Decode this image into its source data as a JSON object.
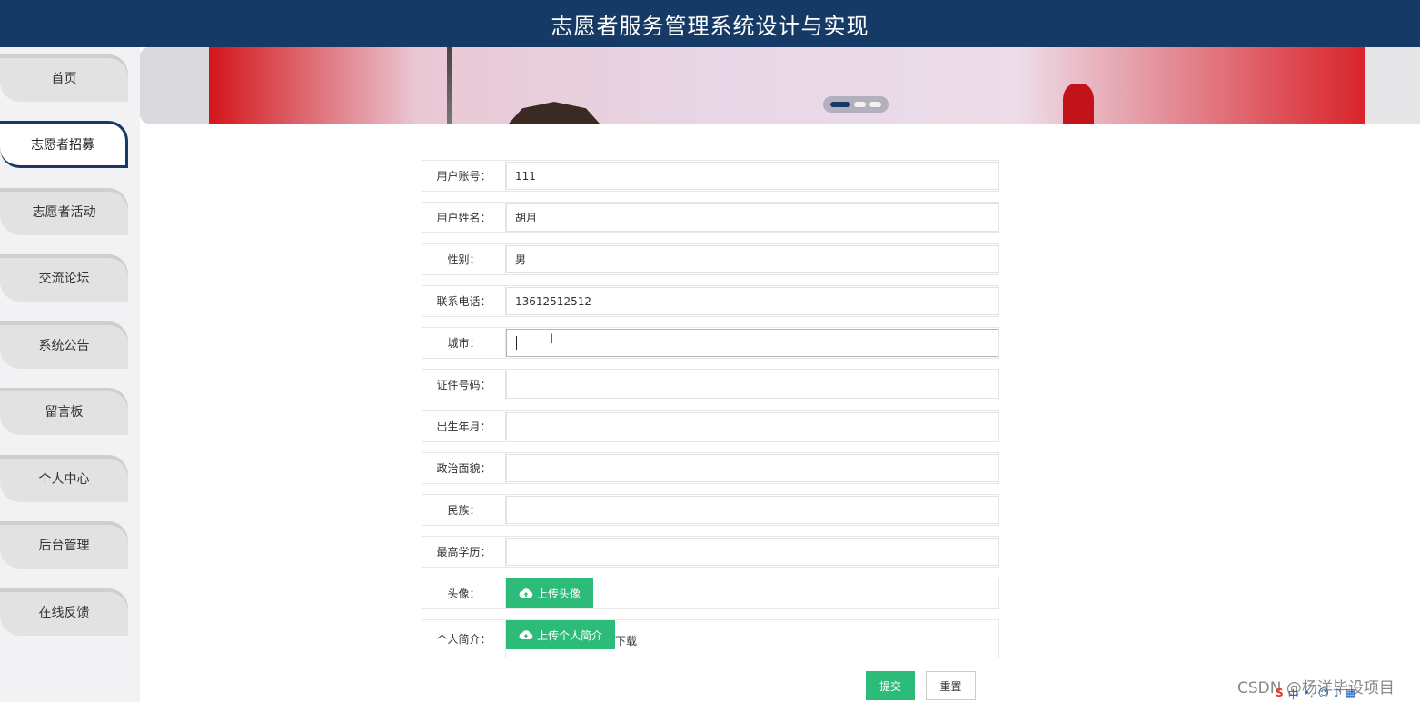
{
  "header": {
    "title": "志愿者服务管理系统设计与实现"
  },
  "sidebar": {
    "items": [
      {
        "label": "首页",
        "active": false
      },
      {
        "label": "志愿者招募",
        "active": true
      },
      {
        "label": "志愿者活动",
        "active": false
      },
      {
        "label": "交流论坛",
        "active": false
      },
      {
        "label": "系统公告",
        "active": false
      },
      {
        "label": "留言板",
        "active": false
      },
      {
        "label": "个人中心",
        "active": false
      },
      {
        "label": "后台管理",
        "active": false
      },
      {
        "label": "在线反馈",
        "active": false
      }
    ]
  },
  "banner": {
    "slides": 3,
    "active_slide": 1
  },
  "form": {
    "fields": [
      {
        "label": "用户账号：",
        "value": "111"
      },
      {
        "label": "用户姓名：",
        "value": "胡月"
      },
      {
        "label": "性别：",
        "value": "男"
      },
      {
        "label": "联系电话：",
        "value": "13612512512"
      },
      {
        "label": "城市：",
        "value": ""
      },
      {
        "label": "证件号码：",
        "value": ""
      },
      {
        "label": "出生年月：",
        "value": ""
      },
      {
        "label": "政治面貌：",
        "value": ""
      },
      {
        "label": "民族：",
        "value": ""
      },
      {
        "label": "最高学历：",
        "value": ""
      }
    ],
    "avatar": {
      "label": "头像：",
      "button": "上传头像"
    },
    "intro": {
      "label": "个人简介：",
      "button": "上传个人简介",
      "download": "下载"
    },
    "submit": "提交",
    "reset": "重置"
  },
  "colors": {
    "header": "#163a66",
    "accent": "#2dbb7a"
  },
  "overlay": {
    "watermark": "CSDN @杨洋毕设项目",
    "ime_label": "中"
  }
}
